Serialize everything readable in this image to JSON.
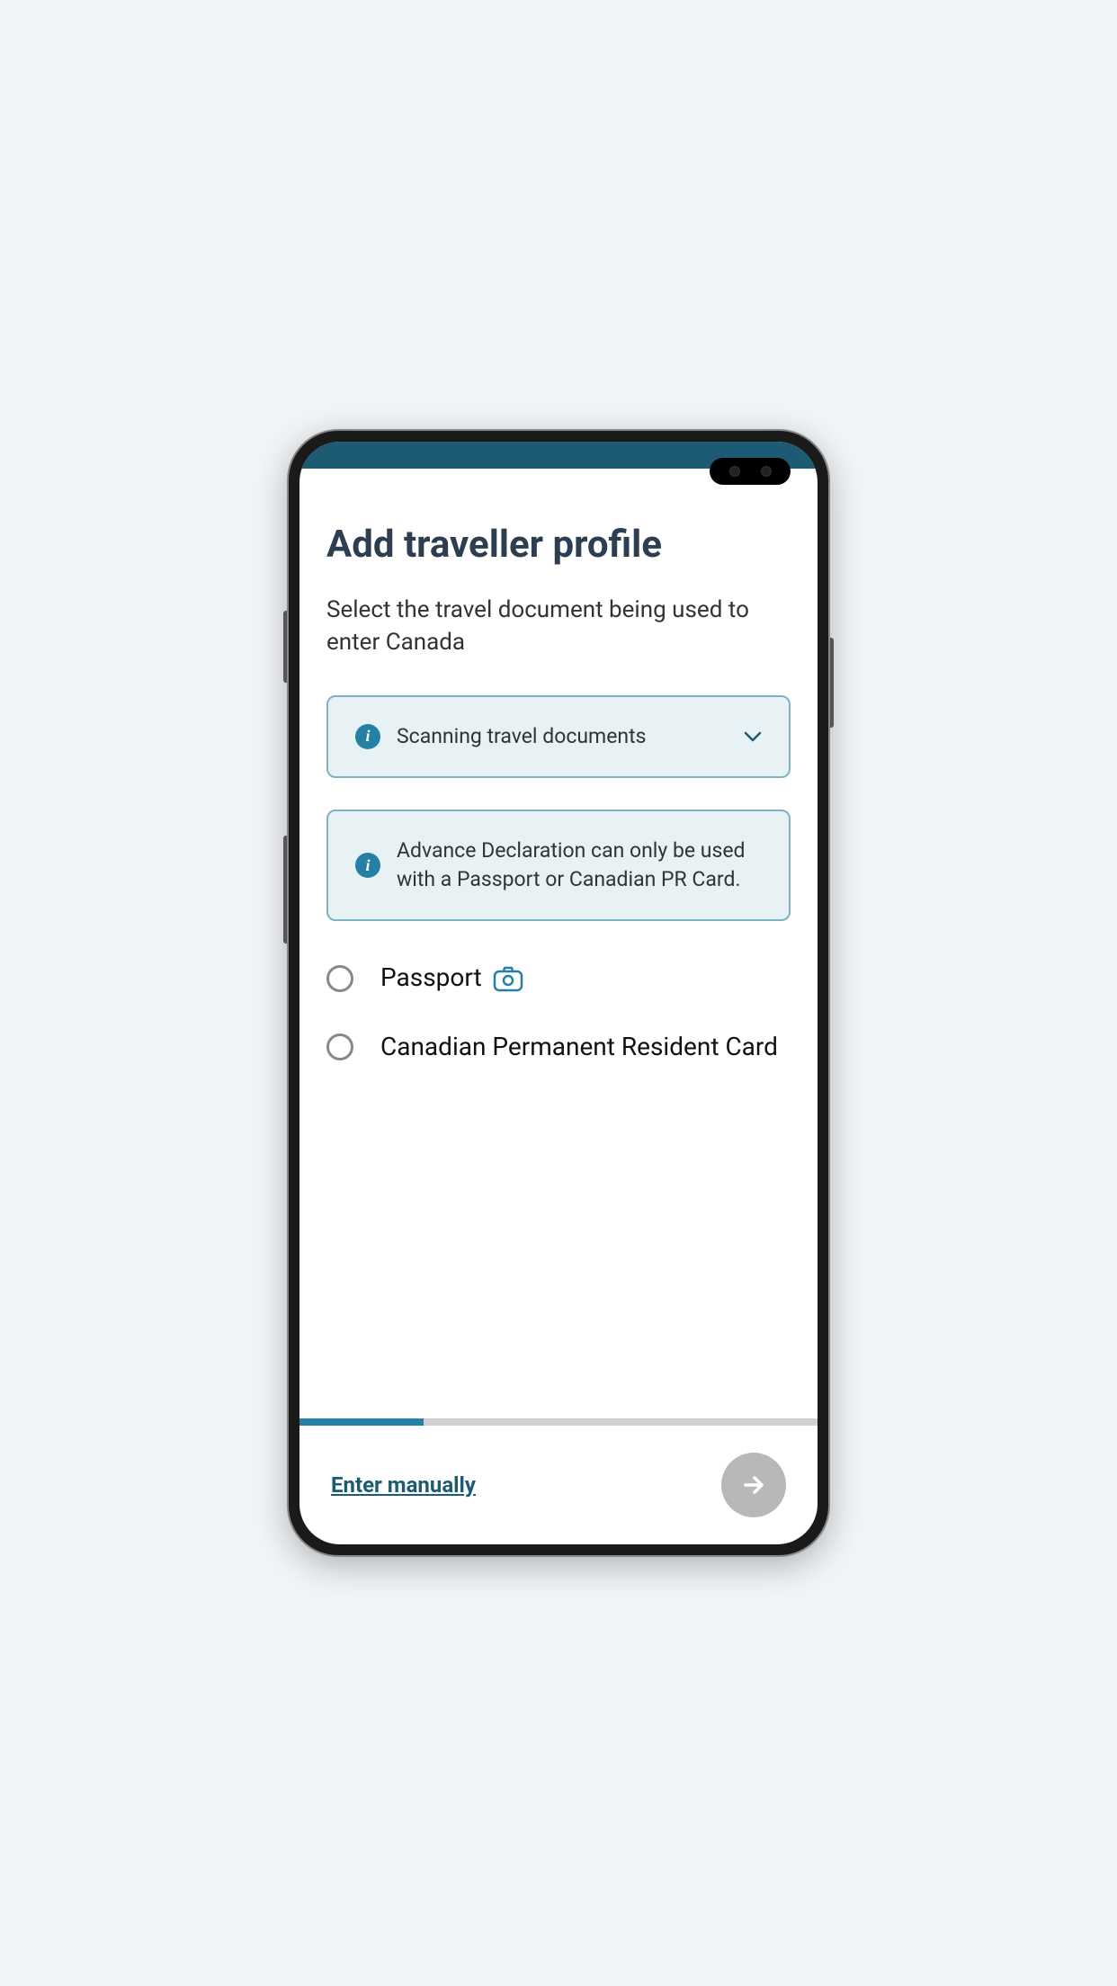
{
  "colors": {
    "accent": "#2580a5",
    "header_bar": "#1d5b75",
    "info_bg": "#e8f2f5",
    "info_border": "#7fb3c4"
  },
  "page": {
    "title": "Add traveller profile",
    "subtitle": "Select the travel document being used to enter Canada"
  },
  "info_cards": {
    "scanning": {
      "text": "Scanning travel documents",
      "expandable": true
    },
    "declaration": {
      "text": "Advance Declaration can only be used with a Passport or Canadian PR Card."
    }
  },
  "options": [
    {
      "label": "Passport",
      "has_camera": true,
      "selected": false
    },
    {
      "label": "Canadian Permanent Resident Card",
      "has_camera": false,
      "selected": false
    }
  ],
  "progress": {
    "percent": 24
  },
  "footer": {
    "manual_link": "Enter manually"
  }
}
